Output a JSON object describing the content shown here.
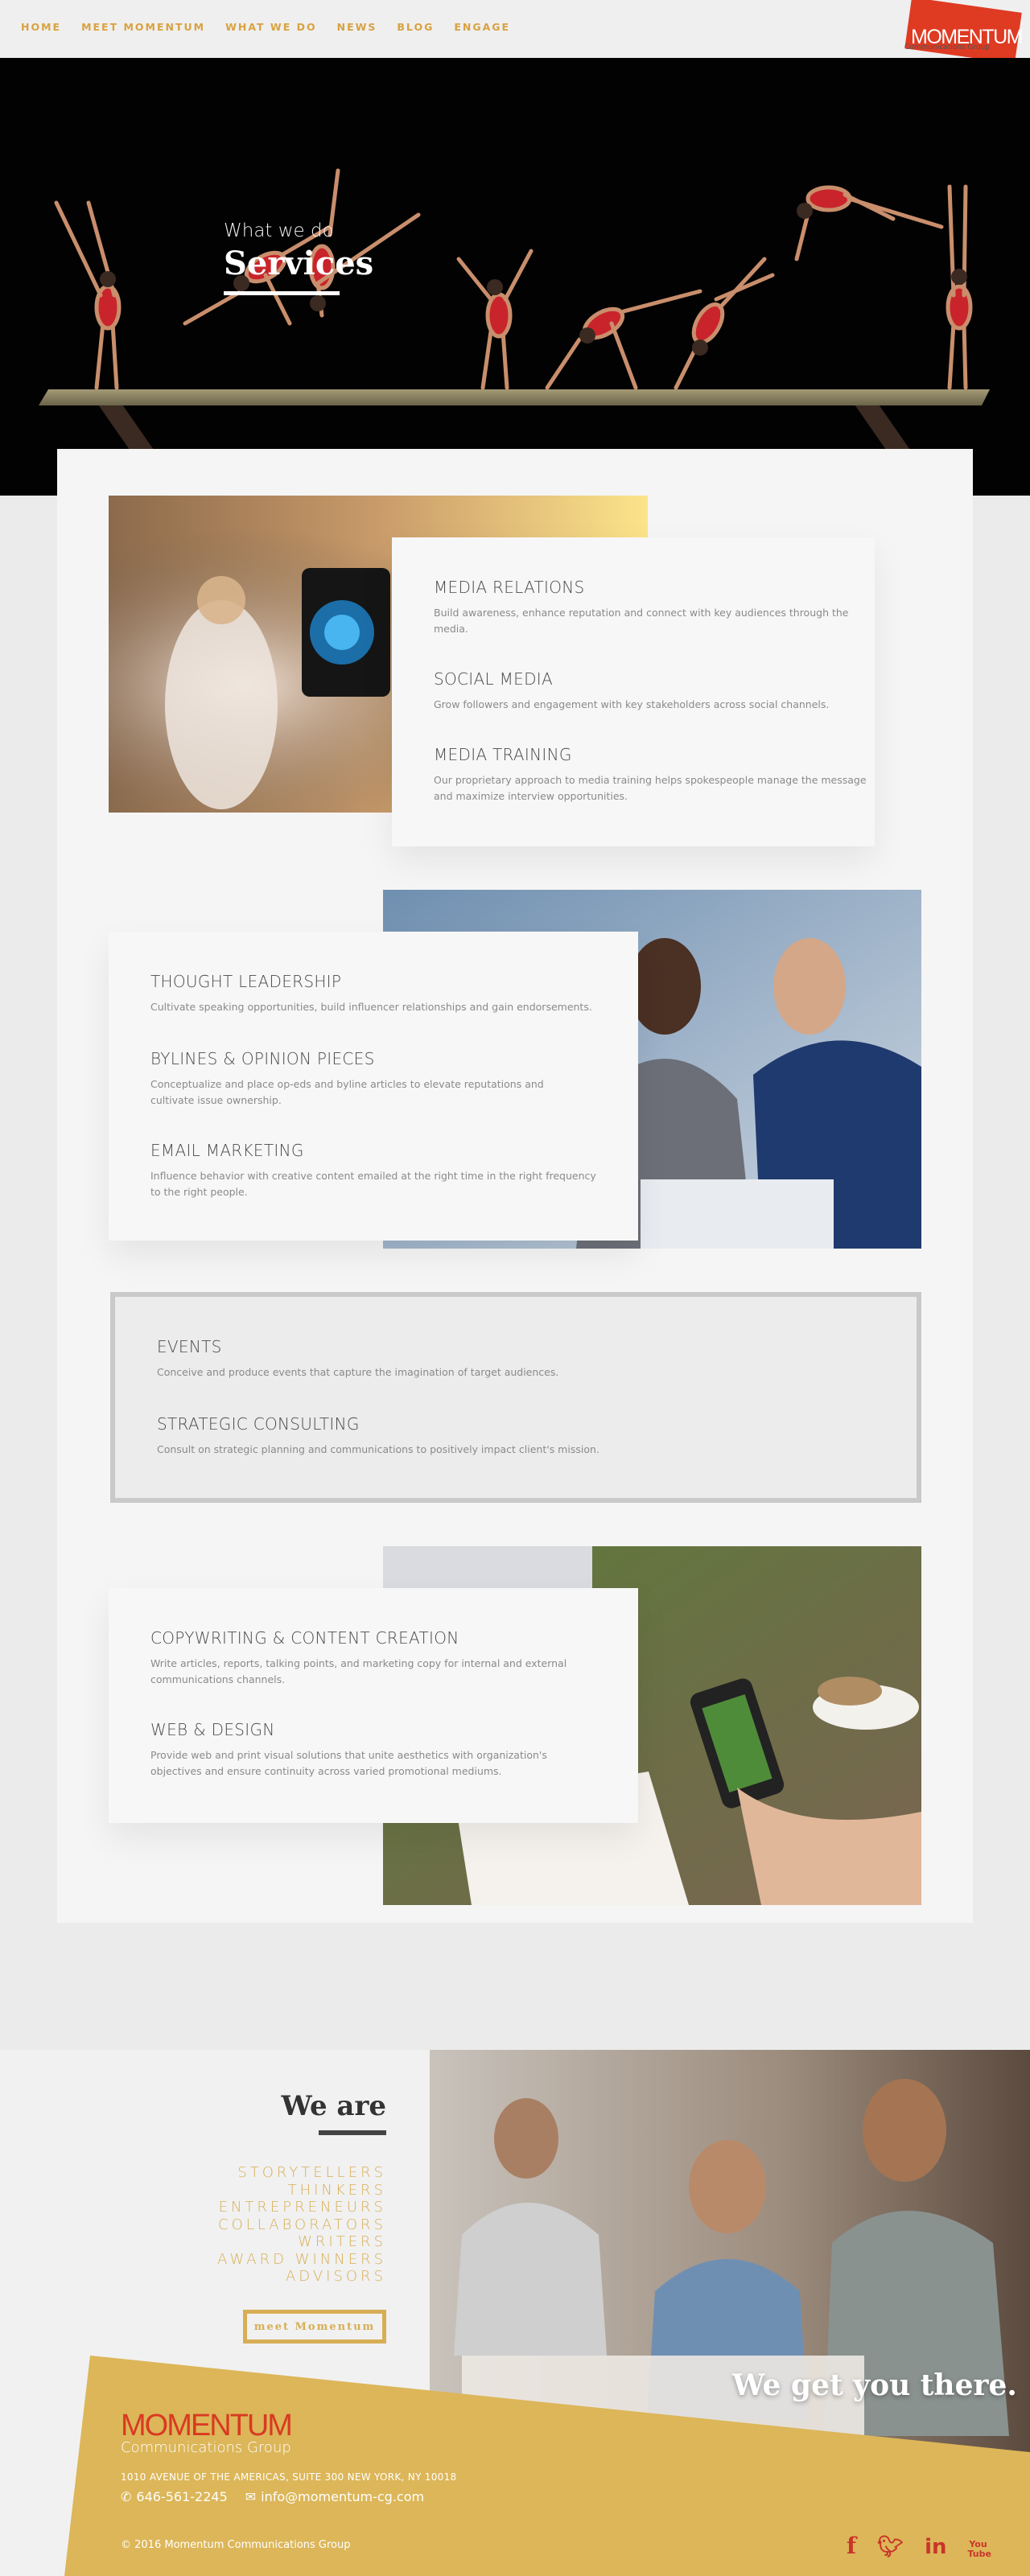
{
  "nav": {
    "links": [
      "HOME",
      "MEET MOMENTUM",
      "WHAT WE DO",
      "NEWS",
      "BLOG",
      "ENGAGE"
    ],
    "logo_text": "MOMENTUM",
    "logo_sub": "Communications Group"
  },
  "hero": {
    "kicker": "What we do",
    "title": "Services"
  },
  "services": {
    "group1": [
      {
        "title": "MEDIA RELATIONS",
        "desc": "Build awareness, enhance reputation and connect with key audiences through the media."
      },
      {
        "title": "SOCIAL MEDIA",
        "desc": "Grow followers and engagement with key stakeholders across social channels."
      },
      {
        "title": "MEDIA TRAINING",
        "desc": "Our proprietary approach to media training helps spokespeople manage the message and maximize interview opportunities."
      }
    ],
    "group2": [
      {
        "title": "THOUGHT LEADERSHIP",
        "desc": "Cultivate speaking opportunities, build influencer relationships and gain endorsements."
      },
      {
        "title": "BYLINES & OPINION PIECES",
        "desc": "Conceptualize and place op-eds and byline articles to elevate reputations and cultivate issue ownership."
      },
      {
        "title": "EMAIL MARKETING",
        "desc": "Influence behavior with creative content emailed at the right time in the right frequency to the right people."
      }
    ],
    "group3": [
      {
        "title": "EVENTS",
        "desc": "Conceive and produce events that capture the imagination of target audiences."
      },
      {
        "title": "STRATEGIC CONSULTING",
        "desc": "Consult on strategic planning and communications to positively impact client's mission."
      }
    ],
    "group4": [
      {
        "title": "COPYWRITING & CONTENT CREATION",
        "desc": "Write articles, reports, talking points, and marketing copy for internal and external communications channels."
      },
      {
        "title": "WEB & DESIGN",
        "desc": "Provide web and print visual solutions that unite aesthetics with organization's objectives and ensure continuity across varied promotional mediums."
      }
    ]
  },
  "weare": {
    "title": "We are",
    "items": [
      "STORYTELLERS",
      "THINKERS",
      "ENTREPRENEURS",
      "COLLABORATORS",
      "WRITERS",
      "AWARD WINNERS",
      "ADVISORS"
    ],
    "button": "meet Momentum",
    "tagline": "We get you there."
  },
  "footer": {
    "logo": "MOMENTUM",
    "logo_sub": "Communications Group",
    "address": "1010 AVENUE OF THE AMERICAS, SUITE 300 NEW YORK, NY 10018",
    "phone": "646-561-2245",
    "email": "info@momentum-cg.com",
    "copyright": "© 2016 Momentum Communications Group",
    "socials": [
      "facebook",
      "twitter",
      "linkedin",
      "youtube"
    ],
    "youtube_label": "You Tube"
  },
  "colors": {
    "accent": "#d9a23f",
    "brand_red": "#df3a22",
    "gold": "#dcb658"
  }
}
